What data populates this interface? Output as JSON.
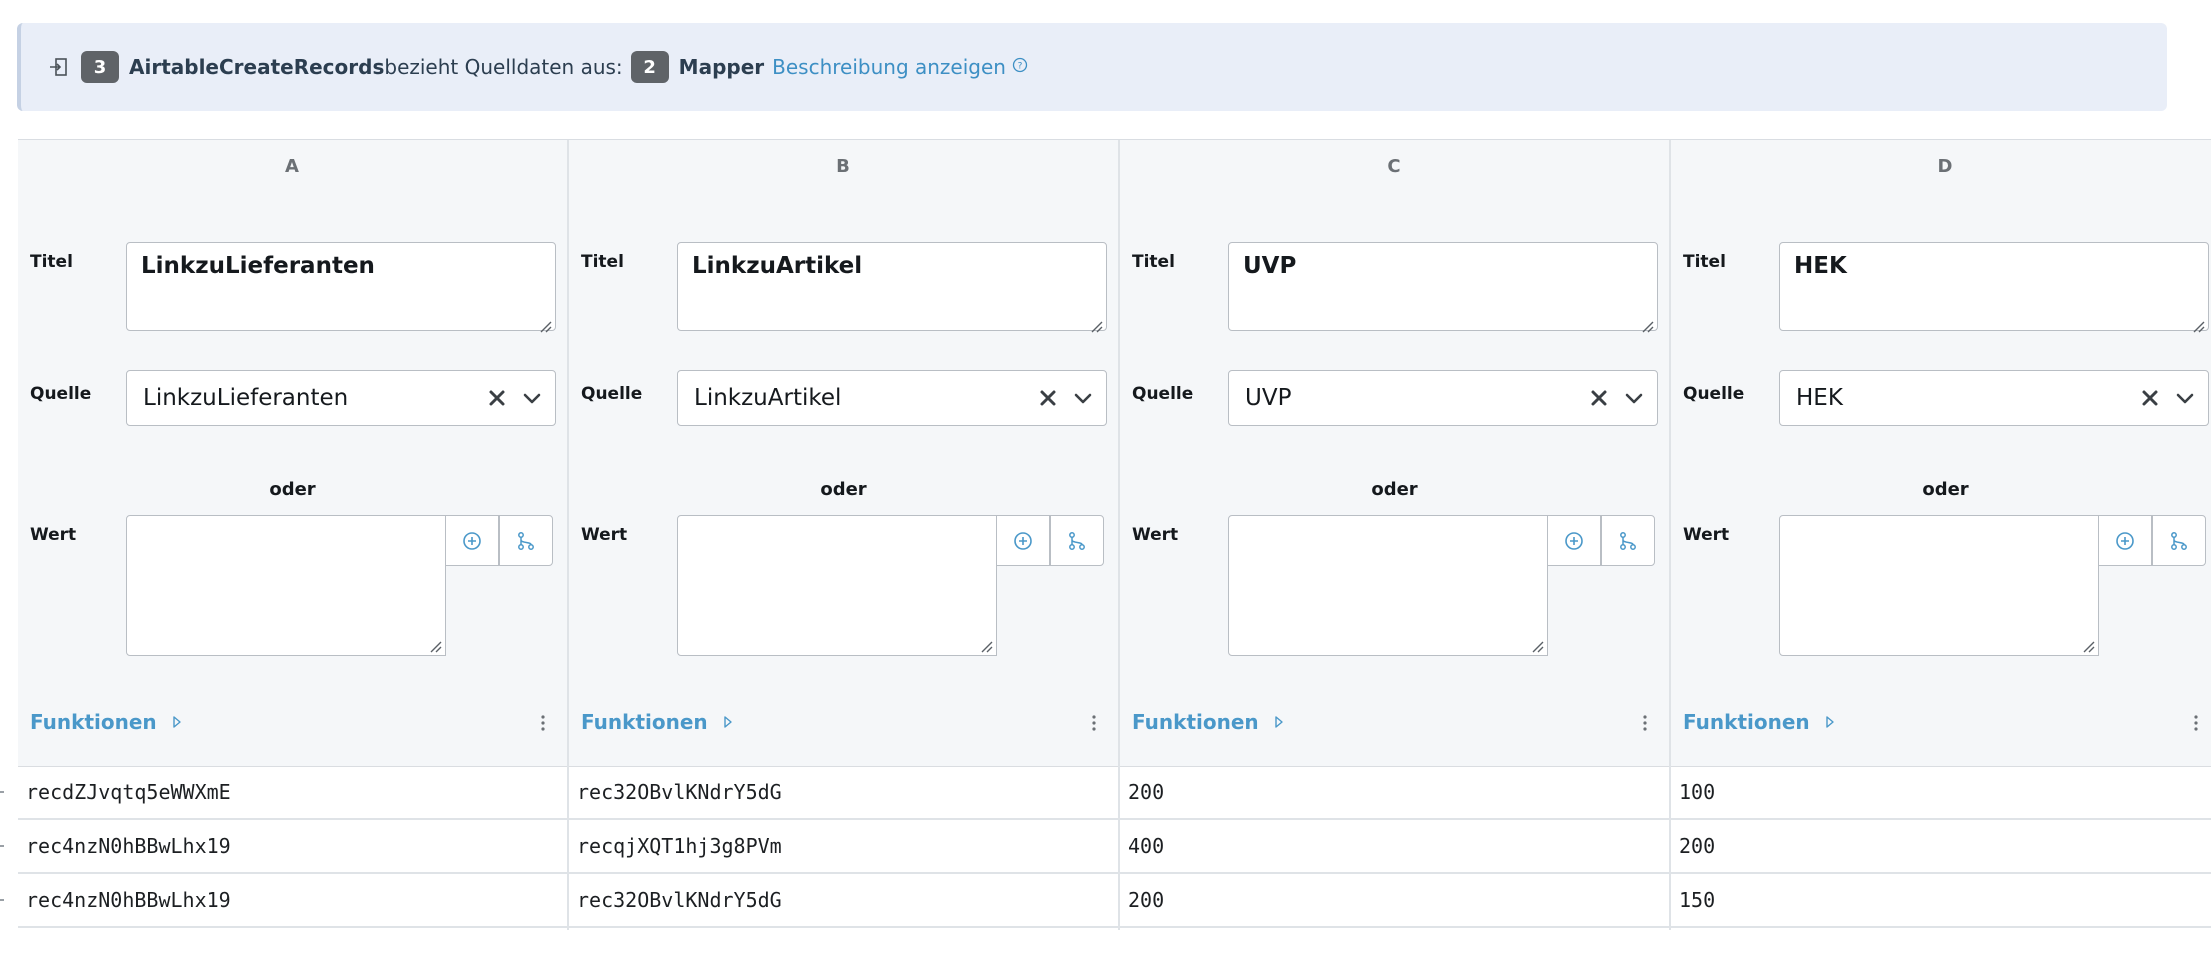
{
  "banner": {
    "step_badge": "3",
    "step_name": "AirtableCreateRecords",
    "text": "bezieht Quelldaten aus:",
    "source_badge": "2",
    "source_name": "Mapper",
    "link": "Beschreibung anzeigen"
  },
  "labels": {
    "titel": "Titel",
    "quelle": "Quelle",
    "oder": "oder",
    "wert": "Wert",
    "funktionen": "Funktionen"
  },
  "columns": [
    {
      "letter": "A",
      "titel": "LinkzuLieferanten",
      "quelle": "LinkzuLieferanten",
      "wert": "",
      "cells": [
        "recdZJvqtq5eWWXmE",
        "rec4nzN0hBBwLhx19",
        "rec4nzN0hBBwLhx19"
      ]
    },
    {
      "letter": "B",
      "titel": "LinkzuArtikel",
      "quelle": "LinkzuArtikel",
      "wert": "",
      "cells": [
        "rec32OBvlKNdrY5dG",
        "recqjXQT1hj3g8PVm",
        "rec32OBvlKNdrY5dG"
      ]
    },
    {
      "letter": "C",
      "titel": "UVP",
      "quelle": "UVP",
      "wert": "",
      "cells": [
        "200",
        "400",
        "200"
      ]
    },
    {
      "letter": "D",
      "titel": "HEK",
      "quelle": "HEK",
      "wert": "",
      "cells": [
        "100",
        "200",
        "150"
      ]
    }
  ],
  "colors": {
    "accent": "#4a98c9",
    "badge": "#5f6368",
    "banner_bg": "#e9eef8"
  }
}
